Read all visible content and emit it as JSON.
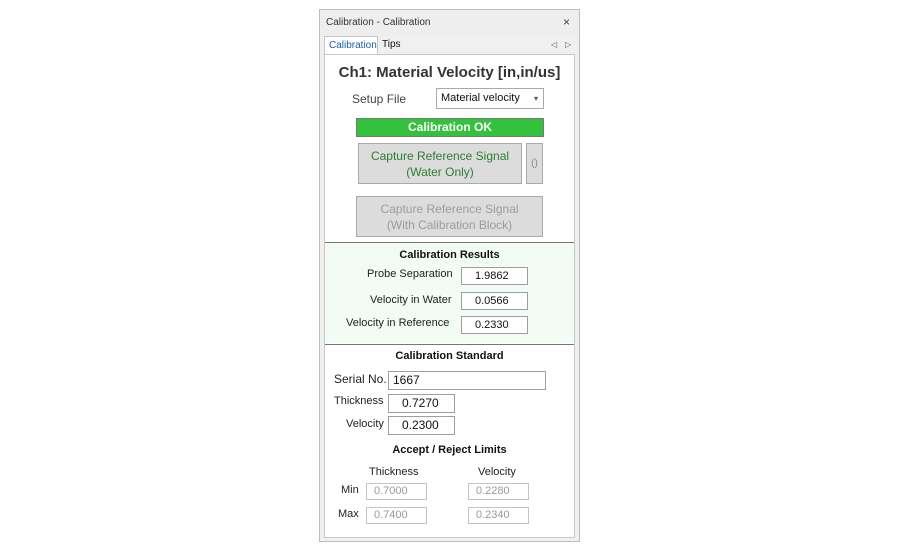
{
  "window": {
    "title": "Calibration - Calibration",
    "close_glyph": "×"
  },
  "tabs": [
    {
      "label": "Calibration",
      "active": true
    },
    {
      "label": "Tips",
      "active": false
    }
  ],
  "tab_nav": {
    "prev_glyph": "◁",
    "next_glyph": "▷"
  },
  "heading": "Ch1: Material Velocity [in,in/us]",
  "setup_file": {
    "label": "Setup File",
    "value": "Material velocity",
    "caret": "▾"
  },
  "status": {
    "text": "Calibration OK",
    "color": "#34c23e"
  },
  "buttons": {
    "capture_water_line1": "Capture Reference Signal",
    "capture_water_line2": "(Water Only)",
    "refresh_glyph": "()",
    "capture_block_line1": "Capture Reference Signal",
    "capture_block_line2": "(With Calibration Block)"
  },
  "results": {
    "title": "Calibration Results",
    "probe_separation": {
      "label": "Probe Separation",
      "value": "1.9862"
    },
    "velocity_water": {
      "label": "Velocity in Water",
      "value": "0.0566"
    },
    "velocity_reference": {
      "label": "Velocity in Reference",
      "value": "0.2330"
    }
  },
  "standard": {
    "title": "Calibration Standard",
    "serial": {
      "label": "Serial No.",
      "value": "1667"
    },
    "thickness": {
      "label": "Thickness",
      "value": "0.7270"
    },
    "velocity": {
      "label": "Velocity",
      "value": "0.2300"
    }
  },
  "limits": {
    "title": "Accept / Reject Limits",
    "col_thickness": "Thickness",
    "col_velocity": "Velocity",
    "min_label": "Min",
    "max_label": "Max",
    "min_thickness": "0.7000",
    "min_velocity": "0.2280",
    "max_thickness": "0.7400",
    "max_velocity": "0.2340"
  }
}
